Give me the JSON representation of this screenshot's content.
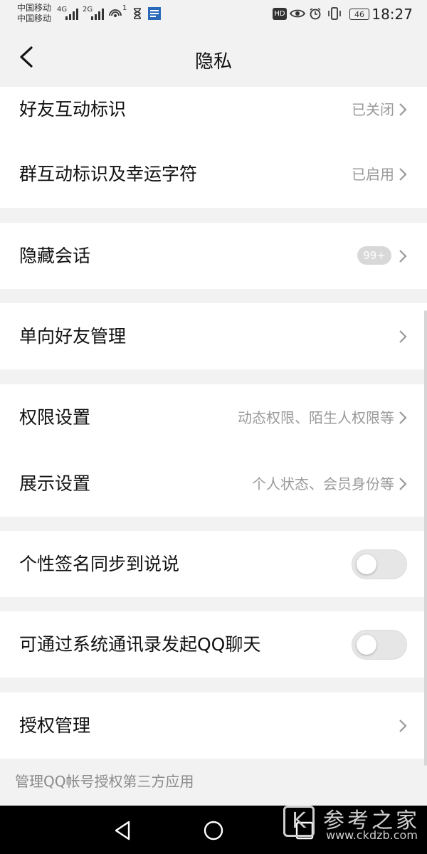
{
  "status_bar": {
    "carrier_1": "中国移动",
    "carrier_2": "中国移动",
    "net_1": "4G",
    "net_2": "2G",
    "hotspot_count": "1",
    "hd": "HD",
    "battery": "46",
    "time": "18:27"
  },
  "header": {
    "title": "隐私"
  },
  "sections": {
    "interaction": {
      "friend_label": "好友互动标识",
      "friend_value": "已关闭",
      "group_label": "群互动标识及幸运字符",
      "group_value": "已启用"
    },
    "hidden": {
      "label": "隐藏会话",
      "badge": "99+"
    },
    "oneway": {
      "label": "单向好友管理"
    },
    "settings": {
      "perm_label": "权限设置",
      "perm_value": "动态权限、陌生人权限等",
      "display_label": "展示设置",
      "display_value": "个人状态、会员身份等"
    },
    "signature": {
      "label": "个性签名同步到说说",
      "enabled": false
    },
    "contacts": {
      "label": "可通过系统通讯录发起QQ聊天",
      "enabled": false
    },
    "auth": {
      "label": "授权管理"
    }
  },
  "footer_note": "管理QQ帐号授权第三方应用",
  "watermark": {
    "title": "参考之家",
    "url": "www.ckdzb.com",
    "logo_letter": "K"
  },
  "colors": {
    "background": "#f2f2f2",
    "card": "#ffffff",
    "secondary_text": "#9a9a9a",
    "nav_bar": "#000000"
  }
}
